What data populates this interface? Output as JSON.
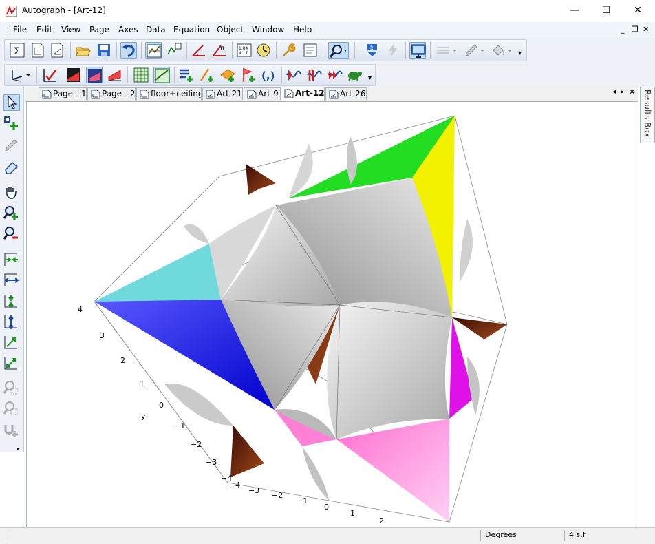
{
  "window": {
    "title": "Autograph - [Art-12]"
  },
  "menu": {
    "items": [
      "File",
      "Edit",
      "View",
      "Page",
      "Axes",
      "Data",
      "Equation",
      "Object",
      "Window",
      "Help"
    ]
  },
  "tabs": [
    {
      "label": "Page - 1"
    },
    {
      "label": "Page - 2"
    },
    {
      "label": "floor+ceiling"
    },
    {
      "label": "Art 21"
    },
    {
      "label": "Art-9"
    },
    {
      "label": "Art-12",
      "active": true
    },
    {
      "label": "Art-26"
    }
  ],
  "results_box": {
    "label": "Results Box"
  },
  "status": {
    "angle_mode": "Degrees",
    "precision": "4 s.f."
  },
  "axes": {
    "y_label": "y",
    "y_ticks": [
      "4",
      "3",
      "2",
      "1",
      "0",
      "−1",
      "−2",
      "−3",
      "−4"
    ],
    "x_ticks": [
      "−4",
      "−3",
      "−2",
      "−1",
      "0",
      "1",
      "2"
    ],
    "corner_tick": "4"
  },
  "colors": {
    "cyan": "#6fd9dc",
    "blue": "#2323ff",
    "green": "#22dd22",
    "yellow": "#f1f100",
    "magenta": "#e010e8",
    "pink": "#ff80d4",
    "brown": "#7a2a10",
    "grey": "#c9c9c9"
  },
  "icons": {
    "app": "autograph-logo-icon"
  }
}
